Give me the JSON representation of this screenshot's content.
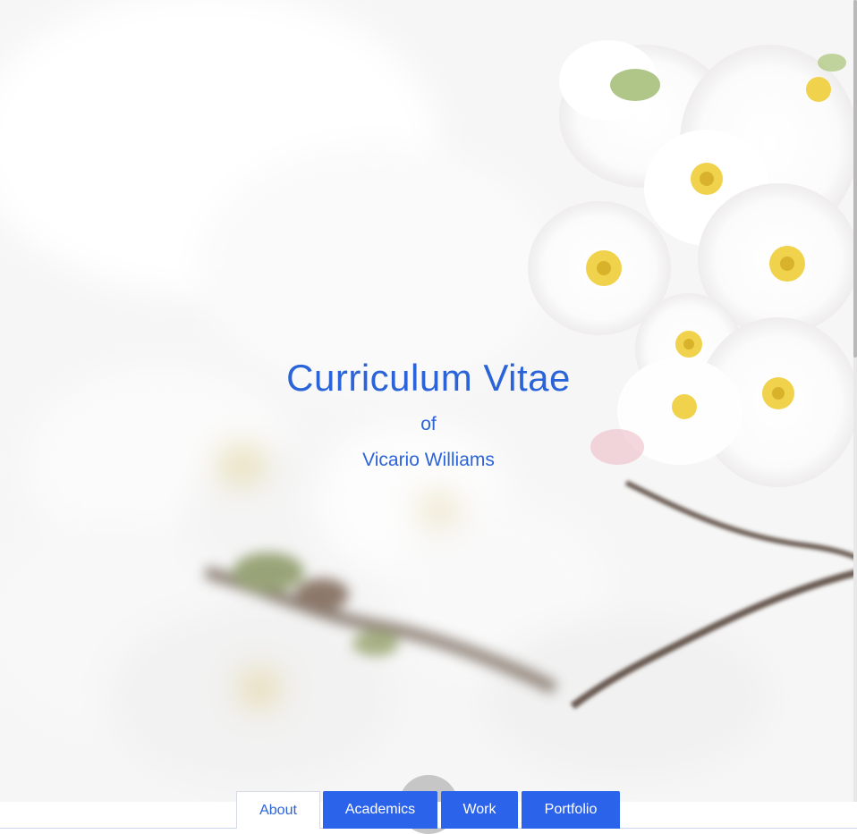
{
  "hero": {
    "title": "Curriculum Vitae",
    "of": "of",
    "name": "Vicario Williams",
    "image": "cherry-blossom-photo"
  },
  "nav": {
    "tabs": [
      {
        "label": "About",
        "active": true
      },
      {
        "label": "Academics",
        "active": false
      },
      {
        "label": "Work",
        "active": false
      },
      {
        "label": "Portfolio",
        "active": false
      }
    ]
  },
  "colors": {
    "accent": "#2b63d9",
    "tab_bg": "#2b63eb",
    "tab_text": "#ffffff"
  }
}
